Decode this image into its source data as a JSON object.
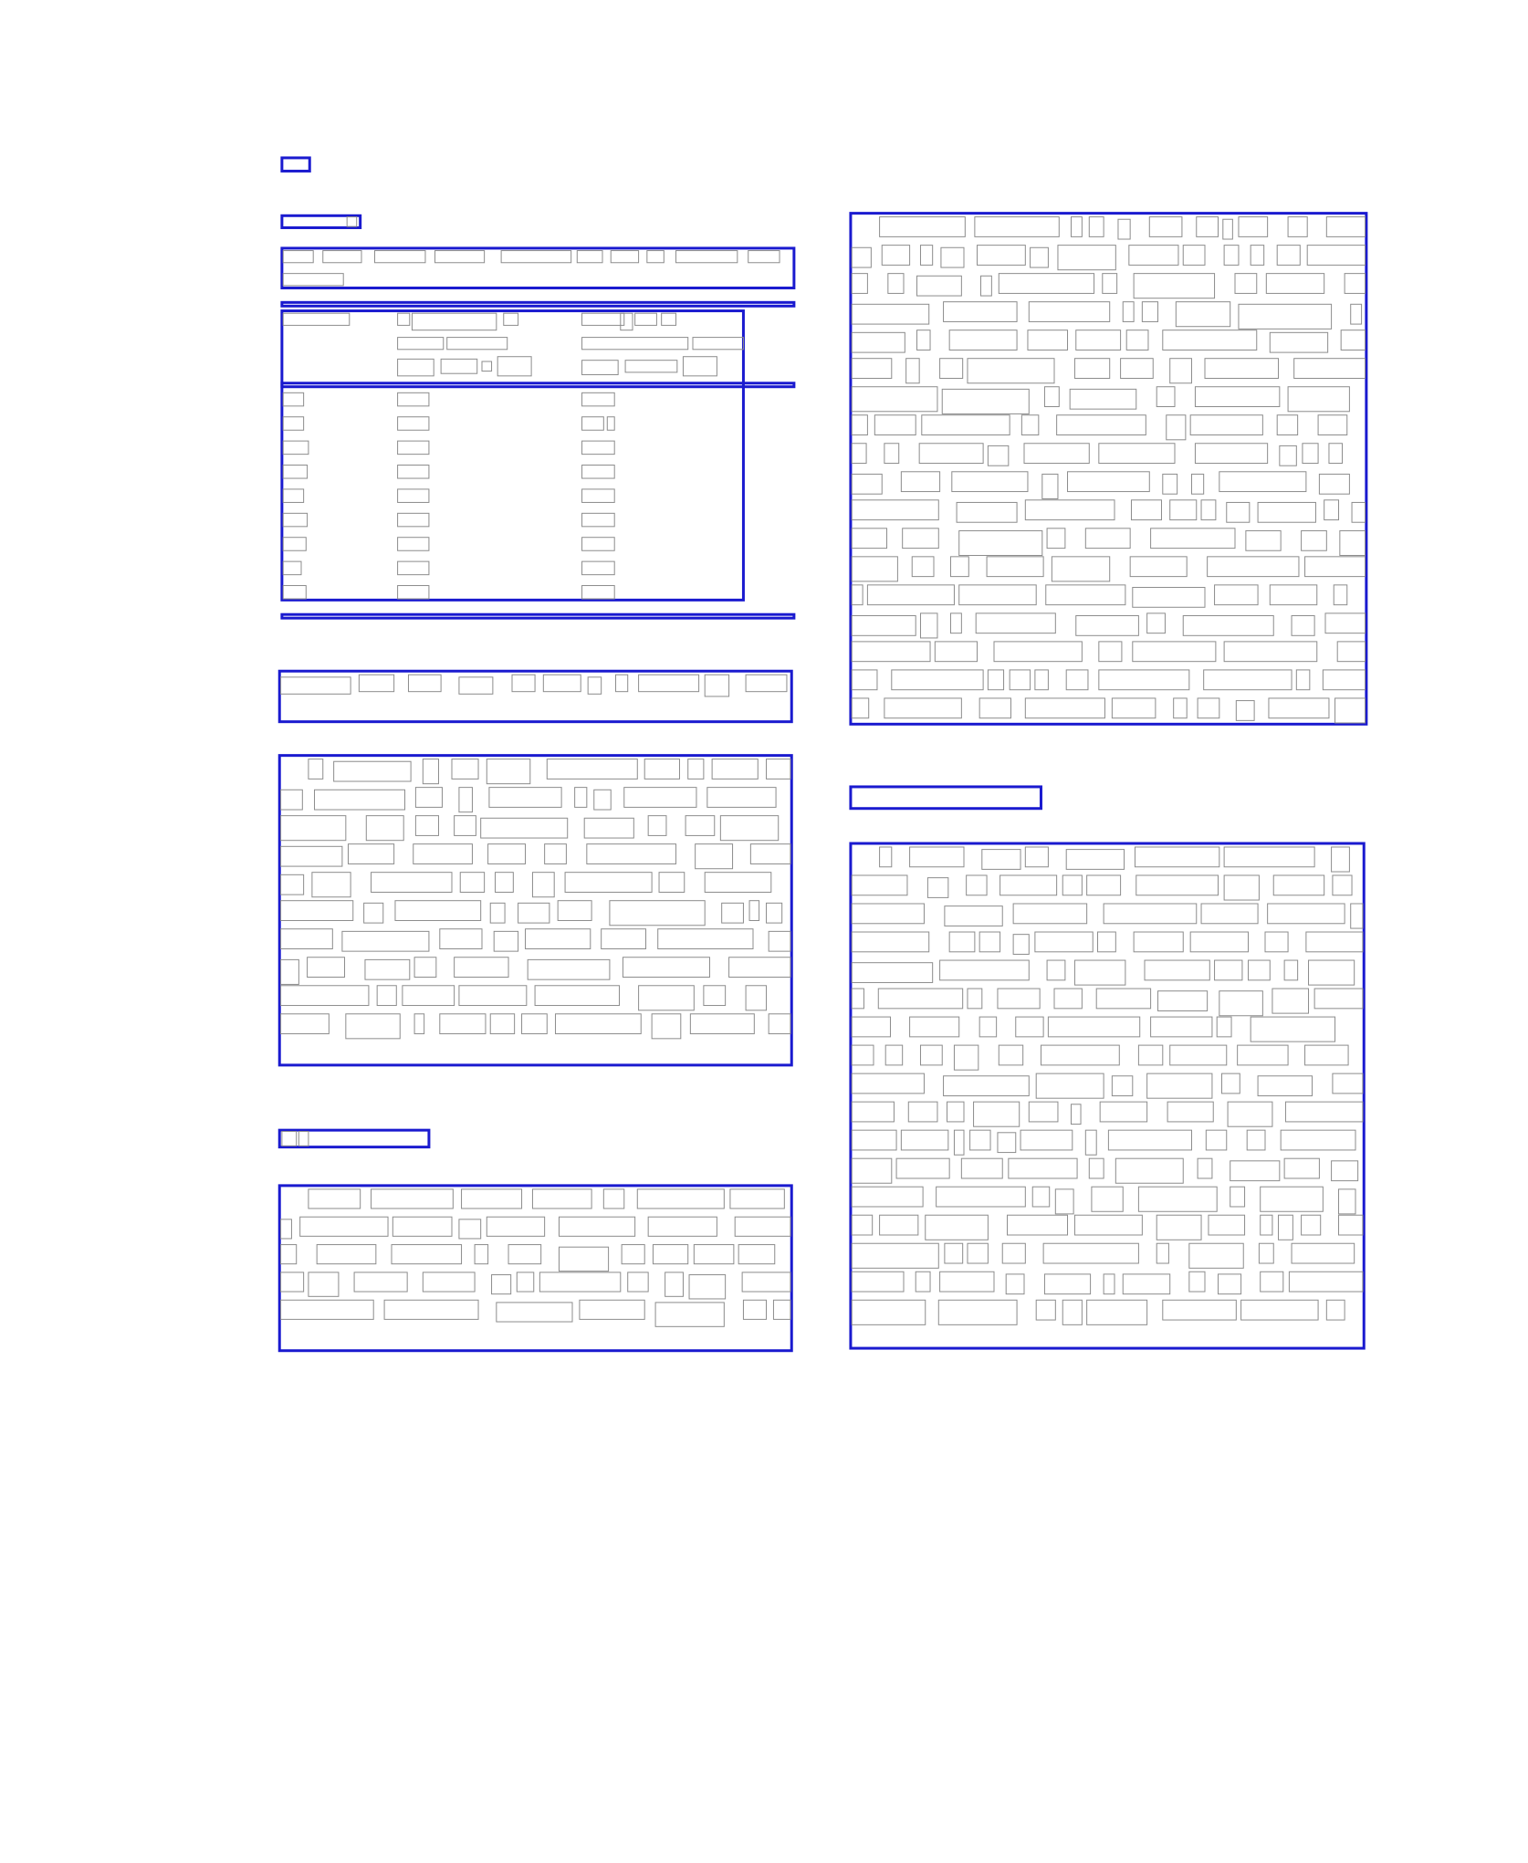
{
  "page": {
    "kind": "layout-annotation",
    "region_color": "#1a1acf",
    "token_color": "#8c8c8c",
    "background": "#ffffff",
    "visible_text": []
  },
  "regions": [
    {
      "name": "page-number-region",
      "kind": "page-number"
    },
    {
      "name": "section-heading-region-1",
      "kind": "section-heading"
    },
    {
      "name": "table-caption-region",
      "kind": "caption"
    },
    {
      "name": "table-top-rule",
      "kind": "rule"
    },
    {
      "name": "table-region",
      "kind": "table"
    },
    {
      "name": "table-header-rule",
      "kind": "rule"
    },
    {
      "name": "table-bottom-rule",
      "kind": "rule"
    },
    {
      "name": "table-note-region",
      "kind": "footnote"
    },
    {
      "name": "paragraph-region-left-1",
      "kind": "paragraph"
    },
    {
      "name": "section-heading-region-2",
      "kind": "section-heading"
    },
    {
      "name": "paragraph-region-left-2",
      "kind": "paragraph"
    },
    {
      "name": "paragraph-region-right-1",
      "kind": "paragraph"
    },
    {
      "name": "section-heading-region-3",
      "kind": "section-heading"
    },
    {
      "name": "paragraph-region-right-2",
      "kind": "paragraph"
    }
  ]
}
